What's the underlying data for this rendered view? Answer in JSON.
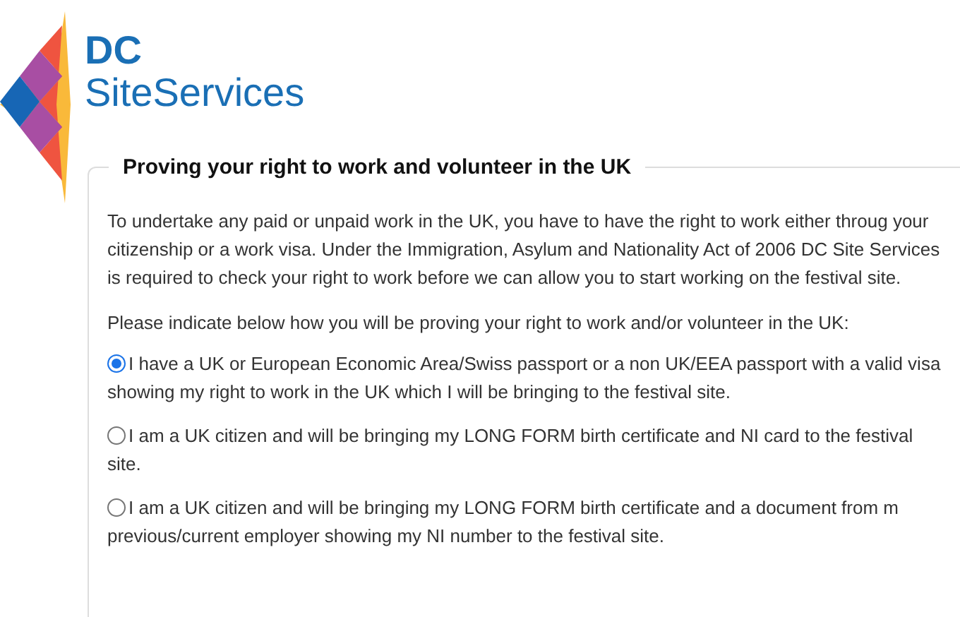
{
  "logo": {
    "line_1": "DC",
    "line_2": "SiteServices"
  },
  "section": {
    "title": "Proving your right to work and volunteer in the UK",
    "intro": "To undertake any paid or unpaid work in the UK, you have to have the right to work either throug your citizenship or a work visa. Under the Immigration, Asylum and Nationality Act of 2006 DC Site Services is required to check your right to work before we can allow you to start working on the festival site.",
    "prompt": "Please indicate below how you will be proving your right to work and/or volunteer in the UK:",
    "options": [
      {
        "label": "I have a UK or European Economic Area/Swiss passport or a non UK/EEA passport with a valid visa showing my right to work in the UK which I will be bringing to the festival site.",
        "selected": true
      },
      {
        "label": "I am a UK citizen and will be bringing my LONG FORM birth certificate and NI card to the festival site.",
        "selected": false
      },
      {
        "label": "I am a UK citizen and will be bringing my LONG FORM birth certificate and a document from m previous/current employer showing my NI number to the festival site.",
        "selected": false
      }
    ]
  }
}
